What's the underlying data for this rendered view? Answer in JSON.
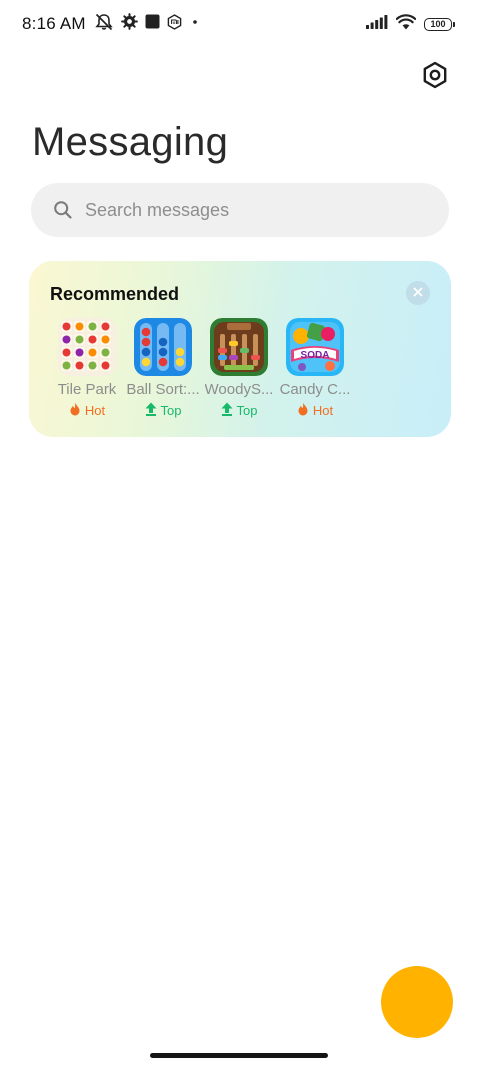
{
  "status_bar": {
    "time": "8:16 AM",
    "battery_level": "100",
    "left_icons": [
      "mute-notification-icon",
      "settings-cog-icon",
      "square-app-icon",
      "mi-icon",
      "dot-icon"
    ],
    "right_icons": [
      "signal-icon",
      "wifi-icon",
      "battery-icon"
    ]
  },
  "header": {
    "title": "Messaging",
    "settings_icon": "settings-hexagon-icon"
  },
  "search": {
    "placeholder": "Search messages",
    "value": ""
  },
  "recommended": {
    "title": "Recommended",
    "apps": [
      {
        "name": "Tile Park",
        "badge": "Hot",
        "badge_type": "hot"
      },
      {
        "name": "Ball Sort:...",
        "badge": "Top",
        "badge_type": "top"
      },
      {
        "name": "WoodyS...",
        "badge": "Top",
        "badge_type": "top"
      },
      {
        "name": "Candy C...",
        "badge": "Hot",
        "badge_type": "hot"
      }
    ]
  },
  "colors": {
    "fab": "#ffb300",
    "hot": "#f26f21",
    "top": "#19b96a"
  }
}
